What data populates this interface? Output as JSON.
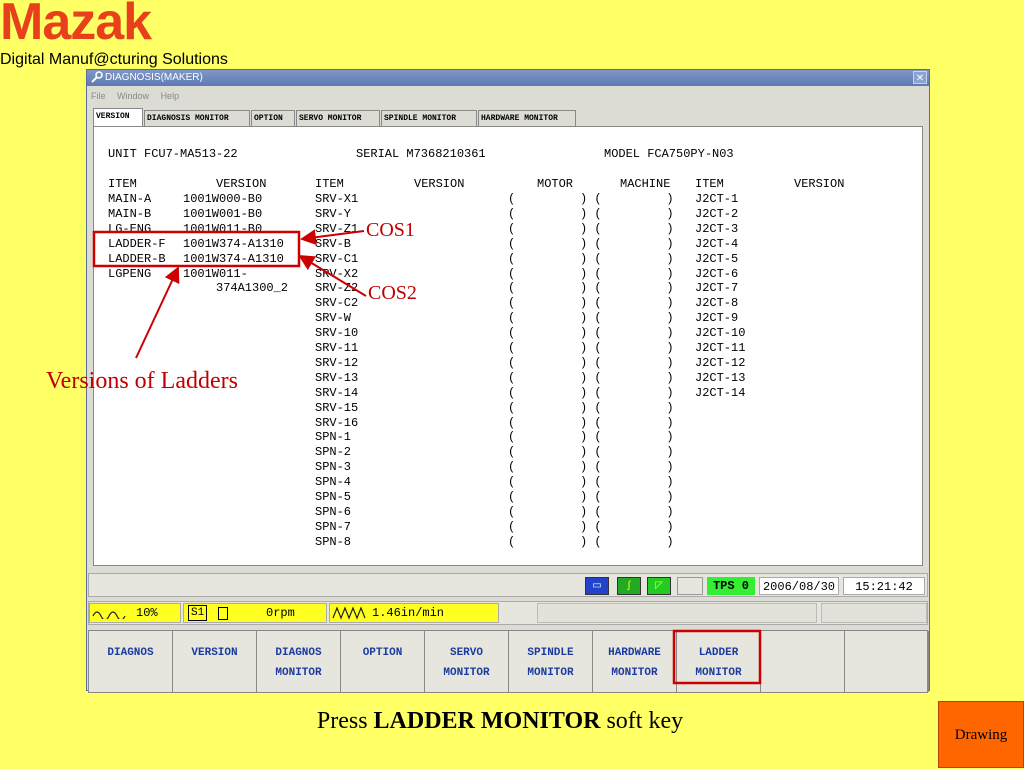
{
  "slide": {
    "logo": "Mazak",
    "tagline": "Digital Manuf@cturing Solutions",
    "caption_pre": "Press ",
    "caption_bold": "LADDER MONITOR",
    "caption_post": " soft key",
    "drawing_button": "Drawing",
    "callouts": {
      "cos1": "COS1",
      "cos2": "COS2",
      "ladders": "Versions of Ladders"
    },
    "highlight_color": "#cc0000"
  },
  "window": {
    "title": "DIAGNOSIS(MAKER)",
    "close": "✕",
    "menu": [
      "File",
      "Window",
      "Help"
    ],
    "tabs": [
      "VERSION",
      "DIAGNOSIS MONITOR",
      "OPTION",
      "SERVO MONITOR",
      "SPINDLE MONITOR",
      "HARDWARE MONITOR"
    ]
  },
  "header": {
    "unit": "UNIT FCU7-MA513-22",
    "serial": "SERIAL M7368210361",
    "model": "MODEL FCA750PY-N03"
  },
  "columns": {
    "item1": "ITEM",
    "version1": "VERSION",
    "item2": "ITEM",
    "version2": "VERSION",
    "motor": "MOTOR",
    "machine": "MACHINE",
    "item3": "ITEM",
    "version3": "VERSION"
  },
  "left_rows": [
    {
      "item": "MAIN-A",
      "version": "1001W000-B0"
    },
    {
      "item": "MAIN-B",
      "version": "1001W001-B0"
    },
    {
      "item": "LG-ENG",
      "version": "1001W011-B0"
    },
    {
      "item": "LADDER-F",
      "version": "1001W374-A1310"
    },
    {
      "item": "LADDER-B",
      "version": "1001W374-A1310"
    },
    {
      "item": "LGPENG",
      "version": "1001W011-"
    },
    {
      "item": "",
      "version": "374A1300_2"
    }
  ],
  "middle_rows": [
    "SRV-X1",
    "SRV-Y",
    "SRV-Z1",
    "SRV-B",
    "SRV-C1",
    "SRV-X2",
    "SRV-Z2",
    "SRV-C2",
    "SRV-W",
    "SRV-10",
    "SRV-11",
    "SRV-12",
    "SRV-13",
    "SRV-14",
    "SRV-15",
    "SRV-16",
    "SPN-1",
    "SPN-2",
    "SPN-3",
    "SPN-4",
    "SPN-5",
    "SPN-6",
    "SPN-7",
    "SPN-8"
  ],
  "paren_cells": "(         ) (         )",
  "right_rows": [
    "J2CT-1",
    "J2CT-2",
    "J2CT-3",
    "J2CT-4",
    "J2CT-5",
    "J2CT-6",
    "J2CT-7",
    "J2CT-8",
    "J2CT-9",
    "J2CT-10",
    "J2CT-11",
    "J2CT-12",
    "J2CT-13",
    "J2CT-14"
  ],
  "status": {
    "tps": "TPS 0",
    "date": "2006/08/30",
    "time": "15:21:42",
    "icons": [
      "screen-icon",
      "tool-icon",
      "comment-icon"
    ]
  },
  "info": {
    "feed_override": "10%",
    "spindle_label": "S1",
    "spindle_speed": "0rpm",
    "feed_rate": "1.46in/min"
  },
  "softkeys": [
    [
      "DIAGNOS",
      ""
    ],
    [
      "VERSION",
      ""
    ],
    [
      "DIAGNOS",
      "MONITOR"
    ],
    [
      "OPTION",
      ""
    ],
    [
      "SERVO",
      "MONITOR"
    ],
    [
      "SPINDLE",
      "MONITOR"
    ],
    [
      "HARDWARE",
      "MONITOR"
    ],
    [
      "LADDER",
      "MONITOR"
    ],
    [
      "",
      ""
    ],
    [
      "",
      ""
    ]
  ]
}
